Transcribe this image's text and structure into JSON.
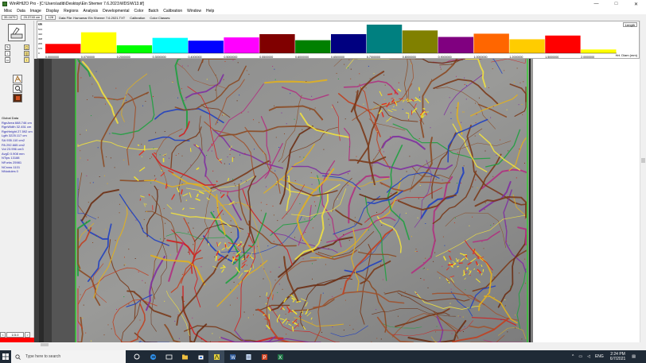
{
  "titlebar": {
    "title": "WinRHIZO Pro - [C:\\Users\\adib\\Desktop\\Ein Shemer 7.6.2021\\WDS\\W13.tif]",
    "min": "—",
    "max": "□",
    "close": "✕"
  },
  "menu": [
    "Misc",
    "Data",
    "Image",
    "Display",
    "Regions",
    "Analysis",
    "Developmental",
    "Color",
    "Batch",
    "Calibration",
    "Window",
    "Help"
  ],
  "status": {
    "field1": "35.1679",
    "field2": "20.3740 cm",
    "field3": "128",
    "datafile": "Data File: Hamamar Ein Shemer 7.6.2021.TXT",
    "calibration": "Calibration",
    "colorclasses": "Color Classes:"
  },
  "histogram": {
    "unit": "cm",
    "toggle": "Length",
    "x_axis_title": "Hrt. Diam (mm)",
    "y_ticks": [
      "615",
      "513",
      "410",
      "308",
      "205",
      "103",
      "0"
    ],
    "x_ticks": [
      "0.0000000",
      "0.0700000",
      "0.2000000",
      "0.3000000",
      "0.4000000",
      "0.5000000",
      "0.5500000",
      "0.6000000",
      "0.6500000",
      "0.7000000",
      "0.8000000",
      "0.9000000",
      "1.0000000",
      "1.2000000",
      "1.5000000",
      "2.0000000"
    ]
  },
  "chart_data": {
    "type": "bar",
    "categories": [
      "0.0000000",
      "0.0700000",
      "0.2000000",
      "0.3000000",
      "0.4000000",
      "0.5000000",
      "0.5500000",
      "0.6000000",
      "0.6500000",
      "0.7000000",
      "0.8000000",
      "0.9000000",
      "1.0000000",
      "1.2000000",
      "1.5000000"
    ],
    "values": [
      200,
      450,
      170,
      330,
      270,
      340,
      410,
      280,
      410,
      615,
      490,
      350,
      420,
      300,
      380,
      80
    ],
    "colors": [
      "#ff0000",
      "#ffff00",
      "#00ff00",
      "#00ffff",
      "#0000ff",
      "#ff00ff",
      "#800000",
      "#008000",
      "#000080",
      "#008080",
      "#808000",
      "#800080",
      "#ff6600",
      "#ffcc00",
      "#ff0000",
      "#ffff00"
    ],
    "ylim": [
      0,
      615
    ],
    "ylabel": "cm",
    "xlabel": "Hrt. Diam (mm)"
  },
  "global_data": {
    "title": "Global Data",
    "rows": [
      "RgnArea 668.746 cm",
      "RgnWidth 32.451 cm",
      "RgnHeight 27.592 cm",
      "Lgth 3225.117 cm",
      "SA 935.110 cm2",
      "PA 292.665 cm2",
      "Vol 23.996 cm3",
      "AvgD 0.908 mm",
      "NTips 13188",
      "NForks 25981",
      "NCross 1101",
      "NNodules 0"
    ]
  },
  "page_counter": {
    "prev": "<",
    "value": "1/3.0",
    "next": ">"
  },
  "taskbar": {
    "search_placeholder": "Type here to search",
    "lang": "ENG",
    "time": "2:24 PM",
    "date": "6/7/2021",
    "up_caret": "^",
    "notif": "▤"
  }
}
